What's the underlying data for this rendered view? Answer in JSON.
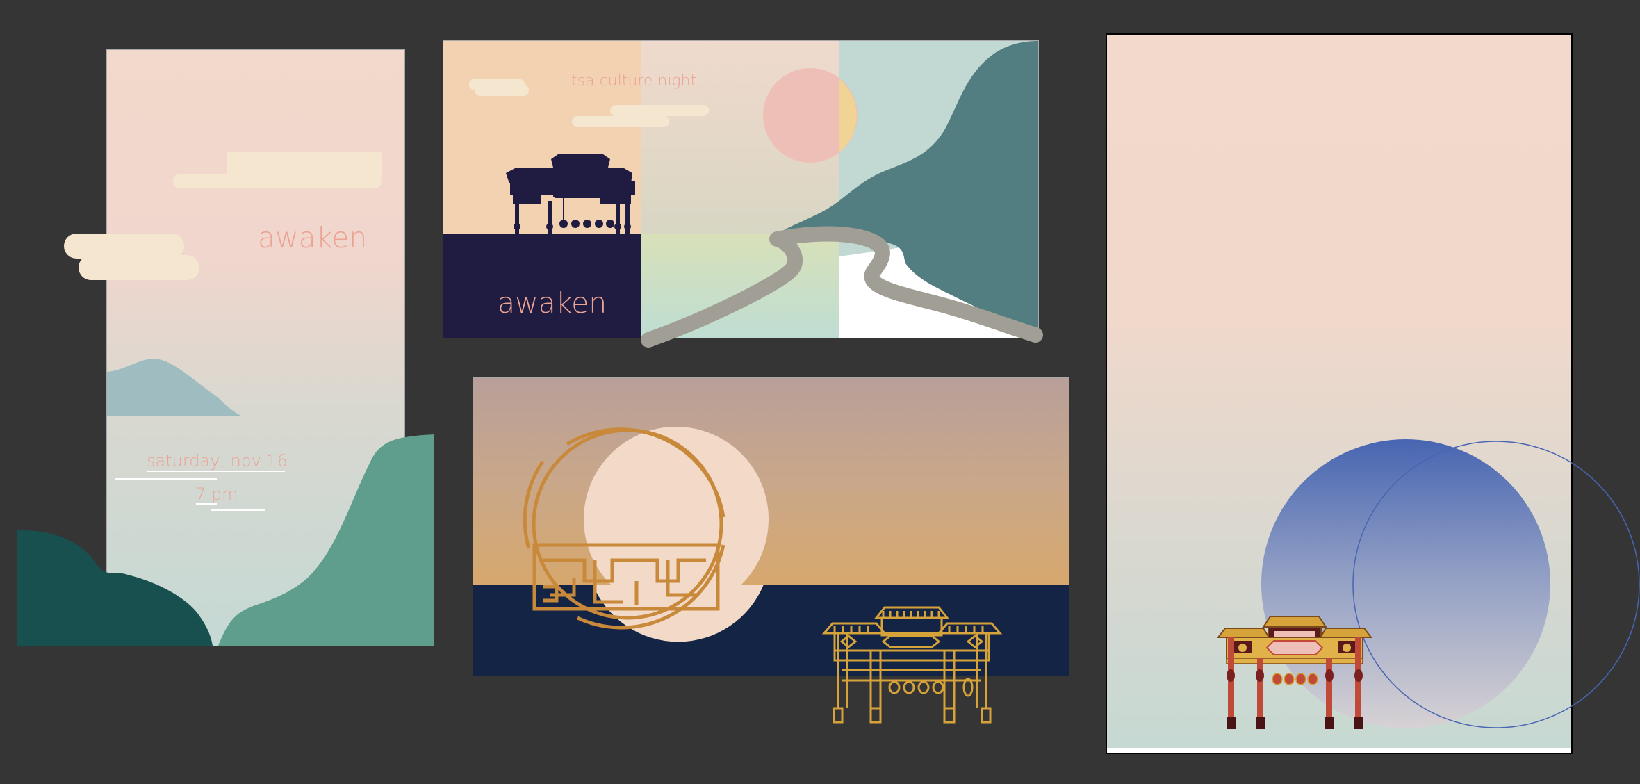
{
  "canvas": {
    "background": "#353535"
  },
  "artboards": [
    {
      "id": "poster-vertical",
      "title": "awaken",
      "date": "saturday, nov 16",
      "time": "7 pm"
    },
    {
      "id": "banner-wide",
      "subtitle": "tsa culture night",
      "title": "awaken"
    },
    {
      "id": "banner-moon"
    },
    {
      "id": "poster-blue-moon"
    }
  ],
  "colors": {
    "peach": "#f3d9cb",
    "cream": "#f5e7cf",
    "salmon_text": "#eba394",
    "navy": "#201b40",
    "teal_dark": "#18504f",
    "teal": "#5f9e8c",
    "teal_blue": "#527e82",
    "gold": "#c8893a",
    "gate_gold": "#d6a23a",
    "moon_pink": "#eebfb6",
    "moon_yellow": "#f1d495",
    "night": "#142444",
    "blue_moon": "#4a68b1",
    "gate_red": "#c04a37"
  },
  "icons": [
    "pavilion-icon",
    "moon-window-icon",
    "archway-gate-icon",
    "red-archway-gate-icon"
  ]
}
